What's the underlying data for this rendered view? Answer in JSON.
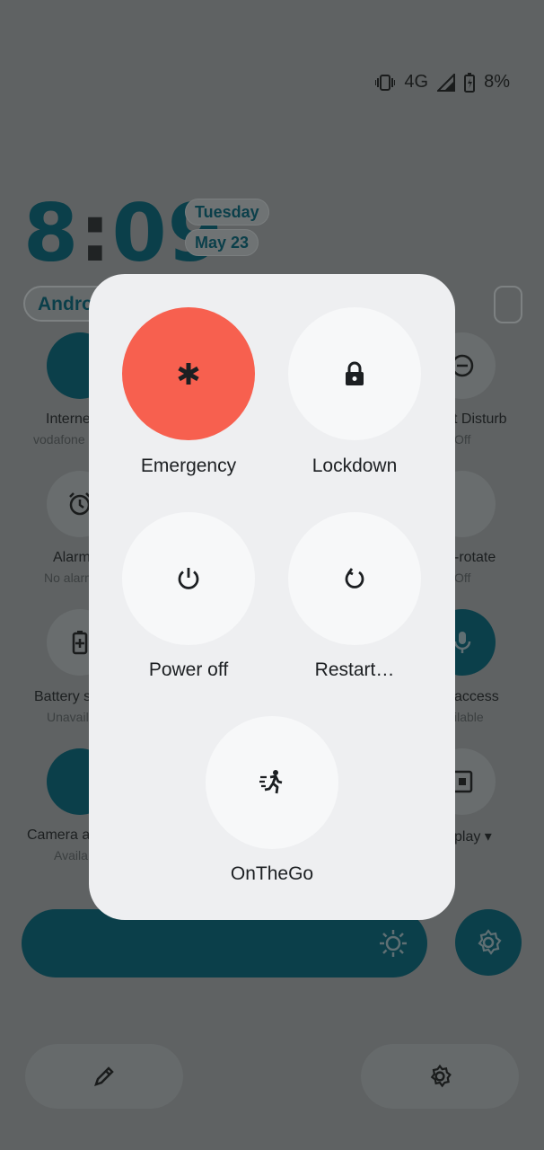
{
  "status_bar": {
    "network": "4G",
    "battery": "8%",
    "icons": [
      "vibrate-icon",
      "signal-icon",
      "battery-charging-icon"
    ]
  },
  "lockscreen": {
    "time": {
      "hours": "8",
      "colon": ":",
      "minutes": "09"
    },
    "day": "Tuesday",
    "date": "May 23",
    "user_pill": "Andro"
  },
  "quick_tiles": {
    "internet": {
      "label": "Interne",
      "sub": "vodafone"
    },
    "dnd": {
      "label": "t Disturb",
      "sub": "Off"
    },
    "alarm": {
      "label": "Alarm",
      "sub": "No alarm"
    },
    "rotate": {
      "label": "-rotate",
      "sub": "Off"
    },
    "battery": {
      "label": "Battery s",
      "sub": "Unavail"
    },
    "mic": {
      "label": "access",
      "sub": "ilable"
    },
    "camera": {
      "label": "Camera a",
      "sub": "Availa"
    },
    "display": {
      "label": "play ▾"
    }
  },
  "power_menu": {
    "emergency": "Emergency",
    "lockdown": "Lockdown",
    "power_off": "Power off",
    "restart": "Restart…",
    "onthego": "OnTheGo"
  },
  "colors": {
    "accent": "#0b3f4a",
    "emergency": "#f7604f",
    "menu_bg": "#eeeff1",
    "scrim": "#5f6263"
  }
}
